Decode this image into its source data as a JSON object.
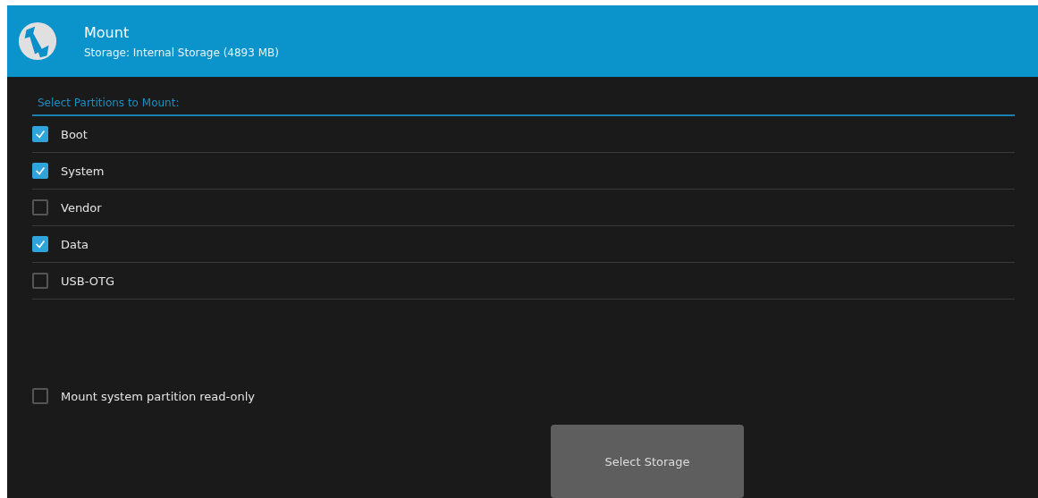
{
  "header": {
    "title": "Mount",
    "subtitle": "Storage: Internal Storage (4893 MB)"
  },
  "section_label": "Select Partitions to Mount:",
  "partitions": [
    {
      "label": "Boot",
      "checked": true
    },
    {
      "label": "System",
      "checked": true
    },
    {
      "label": "Vendor",
      "checked": false
    },
    {
      "label": "Data",
      "checked": true
    },
    {
      "label": "USB-OTG",
      "checked": false
    }
  ],
  "read_only": {
    "label": "Mount system partition read-only",
    "checked": false
  },
  "button": "Select Storage"
}
